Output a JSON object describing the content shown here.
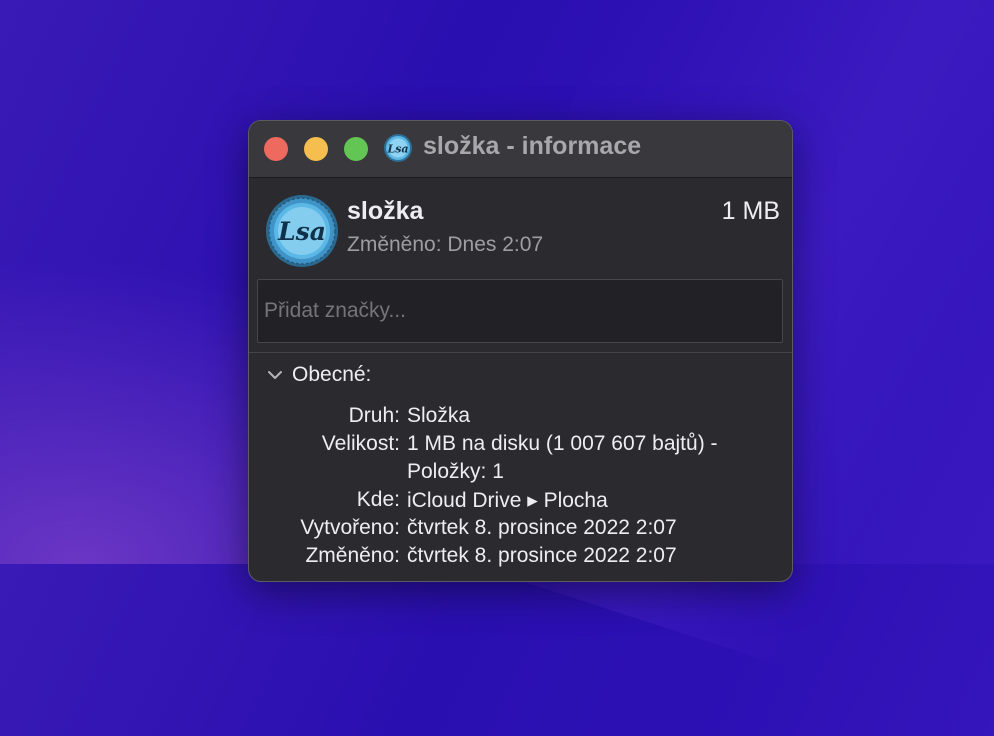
{
  "window": {
    "title": "složka - informace",
    "controls": [
      "close",
      "minimize",
      "maximize"
    ]
  },
  "item": {
    "name": "složka",
    "size": "1 MB",
    "modified": "Změněno: Dnes 2:07",
    "icon": "lsa-badge-icon"
  },
  "tags": {
    "placeholder": "Přidat značky..."
  },
  "general": {
    "header": "Obecné:",
    "rows": [
      {
        "label": "Druh:",
        "value": "Složka"
      },
      {
        "label": "Velikost:",
        "value": "1 MB na disku (1 007 607 bajtů) -"
      },
      {
        "label": "",
        "value": "Položky: 1"
      },
      {
        "label": "Kde:",
        "value": "iCloud Drive ▸ Plocha"
      },
      {
        "label": "Vytvořeno:",
        "value": "čtvrtek 8. prosince 2022 2:07"
      },
      {
        "label": "Změněno:",
        "value": "čtvrtek 8. prosince 2022 2:07"
      }
    ]
  },
  "colors": {
    "accent_close": "#ee6a5f",
    "accent_minimize": "#f5be4f",
    "accent_maximize": "#62c554",
    "icon_blue": "#5bb8e6"
  }
}
